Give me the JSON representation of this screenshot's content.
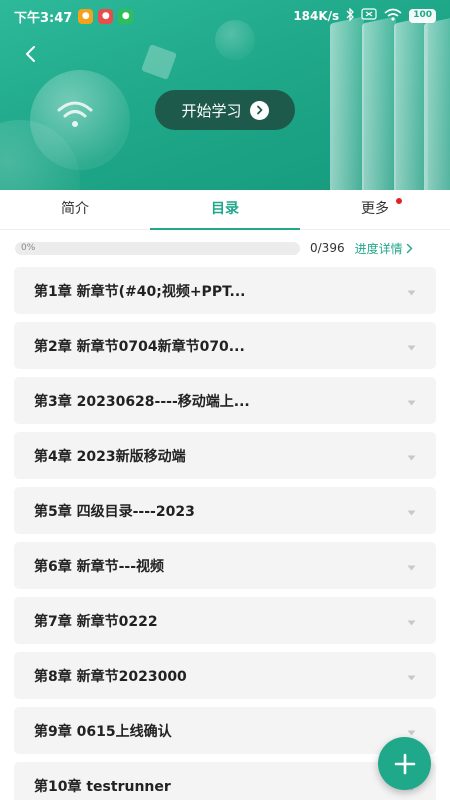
{
  "status_bar": {
    "time": "下午3:47",
    "network_speed": "184K/s",
    "battery": "100",
    "app_icons": [
      "app-icon-1",
      "app-icon-2",
      "app-icon-3"
    ]
  },
  "header": {
    "start_button_label": "开始学习"
  },
  "tabs": [
    {
      "label": "简介",
      "active": false
    },
    {
      "label": "目录",
      "active": true
    },
    {
      "label": "更多",
      "active": false,
      "badge": true
    }
  ],
  "progress": {
    "percent_label": "0%",
    "value": 0,
    "count": "0/396",
    "detail_label": "进度详情"
  },
  "chapters": [
    {
      "title": "第1章 新章节(#40;视频+PPT..."
    },
    {
      "title": "第2章 新章节0704新章节070..."
    },
    {
      "title": "第3章 20230628----移动端上..."
    },
    {
      "title": "第4章 2023新版移动端"
    },
    {
      "title": "第5章 四级目录----2023"
    },
    {
      "title": "第6章 新章节---视频"
    },
    {
      "title": "第7章 新章节0222"
    },
    {
      "title": "第8章 新章节2023000"
    },
    {
      "title": "第9章 0615上线确认"
    },
    {
      "title": "第10章 testrunner"
    }
  ],
  "colors": {
    "accent": "#1fa889",
    "button_dark": "#1d5a4c",
    "badge_red": "#e02424"
  }
}
